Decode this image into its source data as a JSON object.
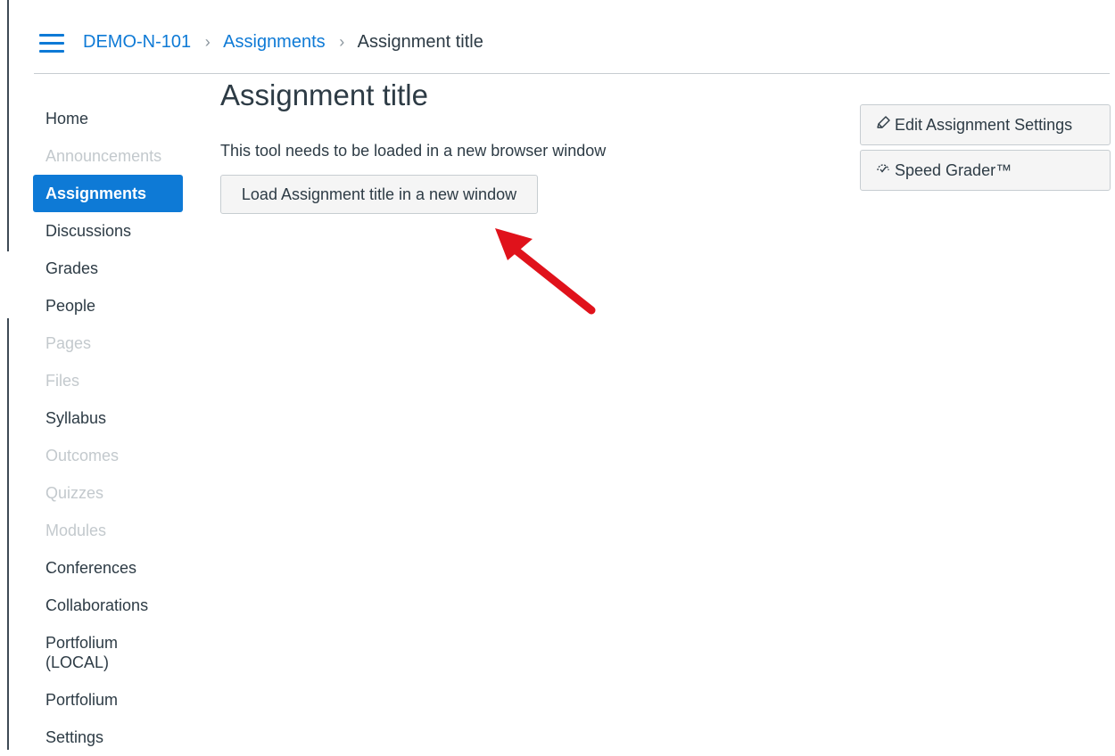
{
  "breadcrumb": {
    "course": "DEMO-N-101",
    "section": "Assignments",
    "current": "Assignment title"
  },
  "sidebar": {
    "items": [
      {
        "label": "Home",
        "state": "normal"
      },
      {
        "label": "Announcements",
        "state": "disabled"
      },
      {
        "label": "Assignments",
        "state": "active"
      },
      {
        "label": "Discussions",
        "state": "normal"
      },
      {
        "label": "Grades",
        "state": "normal"
      },
      {
        "label": "People",
        "state": "normal"
      },
      {
        "label": "Pages",
        "state": "disabled"
      },
      {
        "label": "Files",
        "state": "disabled"
      },
      {
        "label": "Syllabus",
        "state": "normal"
      },
      {
        "label": "Outcomes",
        "state": "disabled"
      },
      {
        "label": "Quizzes",
        "state": "disabled"
      },
      {
        "label": "Modules",
        "state": "disabled"
      },
      {
        "label": "Conferences",
        "state": "normal"
      },
      {
        "label": "Collaborations",
        "state": "normal"
      },
      {
        "label": "Portfolium (LOCAL)",
        "state": "normal"
      },
      {
        "label": "Portfolium",
        "state": "normal"
      },
      {
        "label": "Settings",
        "state": "normal"
      }
    ]
  },
  "main": {
    "title": "Assignment title",
    "notice": "This tool needs to be loaded in a new browser window",
    "load_button": "Load Assignment title in a new window"
  },
  "actions": {
    "edit_settings": "Edit Assignment Settings",
    "speed_grader": "Speed Grader™"
  },
  "colors": {
    "accent": "#0e7ad6",
    "disabled_text": "#c3c9cd",
    "annotation_arrow": "#e0121b"
  },
  "icons": {
    "menu": "hamburger-icon",
    "edit": "pencil-icon",
    "grader": "speedgrader-icon",
    "annotation": "red-arrow-annotation"
  }
}
